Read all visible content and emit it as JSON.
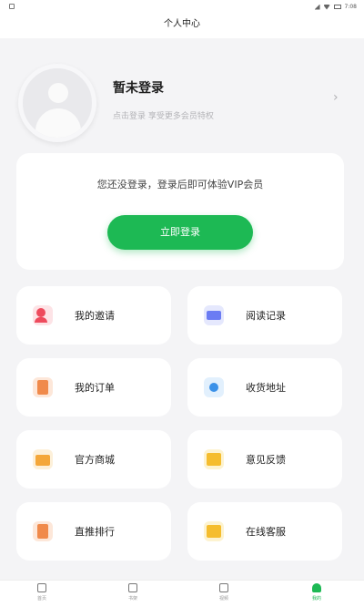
{
  "status_bar": {
    "time": "7:08"
  },
  "header": {
    "title": "个人中心"
  },
  "profile": {
    "name": "暂未登录",
    "subtitle": "点击登录 享受更多会员特权"
  },
  "vip": {
    "message": "您还没登录，登录后即可体验VIP会员",
    "login_button": "立即登录"
  },
  "menu": [
    {
      "label": "我的邀请",
      "icon": "invite-icon"
    },
    {
      "label": "阅读记录",
      "icon": "reading-history-icon"
    },
    {
      "label": "我的订单",
      "icon": "order-icon"
    },
    {
      "label": "收货地址",
      "icon": "address-icon"
    },
    {
      "label": "官方商城",
      "icon": "mall-icon"
    },
    {
      "label": "意见反馈",
      "icon": "feedback-icon"
    },
    {
      "label": "直推排行",
      "icon": "ranking-icon"
    },
    {
      "label": "在线客服",
      "icon": "customer-service-icon"
    }
  ],
  "tabbar": [
    {
      "label": "首页",
      "icon": "home-icon"
    },
    {
      "label": "书架",
      "icon": "bookshelf-icon"
    },
    {
      "label": "视频",
      "icon": "video-icon"
    },
    {
      "label": "我的",
      "icon": "profile-icon",
      "active": true
    }
  ],
  "colors": {
    "accent": "#1db954",
    "background": "#f4f4f6"
  }
}
